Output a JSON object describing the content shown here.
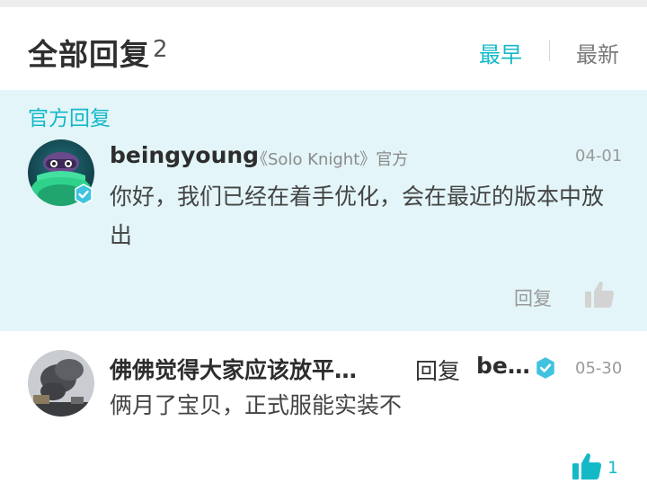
{
  "header": {
    "title": "全部回复",
    "count": "2",
    "sort_earliest": "最早",
    "sort_latest": "最新"
  },
  "official_section": {
    "label": "官方回复",
    "comment": {
      "username": "beingyoung",
      "game_tag": "《Solo Knight》官方",
      "date": "04-01",
      "content": "你好，我们已经在着手优化，会在最近的版本中放出",
      "reply_label": "回复",
      "like_icon": "thumbs-up-icon"
    }
  },
  "comments": [
    {
      "username": "佛佛觉得大家应该放平…",
      "reply_word": "回复",
      "reply_target": "be…",
      "date": "05-30",
      "content": "俩月了宝贝，正式服能实装不",
      "likes": "1",
      "like_icon": "thumbs-up-icon"
    }
  ],
  "colors": {
    "accent": "#14b9c8",
    "official_bg": "#e3f5f8",
    "verified_badge": "#3fc3e0"
  }
}
